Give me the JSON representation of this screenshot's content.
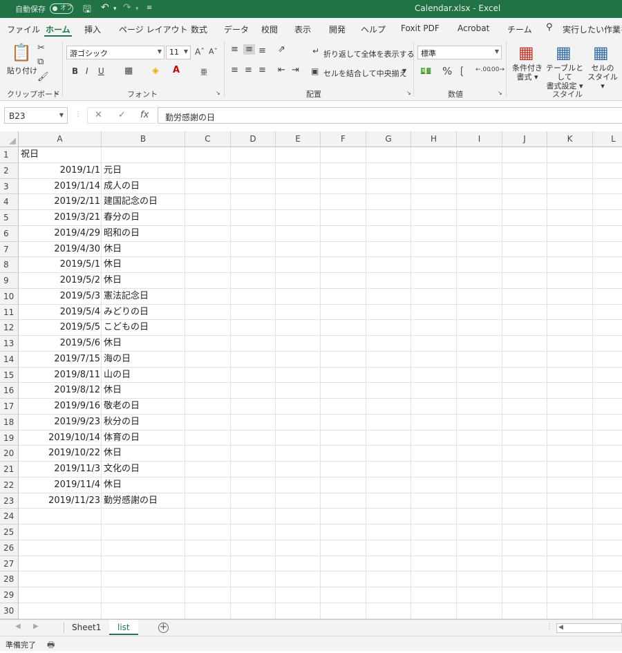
{
  "titlebar": {
    "autosave_label": "自動保存",
    "autosave_state": "オフ",
    "title": "Calendar.xlsx  -  Excel"
  },
  "tabs": [
    "ファイル",
    "ホーム",
    "挿入",
    "ページ レイアウト",
    "数式",
    "データ",
    "校閲",
    "表示",
    "開発",
    "ヘルプ",
    "Foxit PDF",
    "Acrobat",
    "チーム"
  ],
  "active_tab": "ホーム",
  "search_placeholder": "実行したい作業を",
  "ribbon": {
    "clipboard": {
      "paste": "貼り付け",
      "label": "クリップボード"
    },
    "font": {
      "name": "游ゴシック",
      "size": "11",
      "bold": "B",
      "italic": "I",
      "underline": "U",
      "label": "フォント"
    },
    "alignment": {
      "wrap_text": "折り返して全体を表示する",
      "merge_center": "セルを結合して中央揃え",
      "label": "配置"
    },
    "number": {
      "format": "標準",
      "label": "数値"
    },
    "styles": {
      "conditional": "条件付き\n書式",
      "as_table": "テーブルとして\n書式設定",
      "cell_styles": "セルの\nスタイル",
      "label": "スタイル"
    }
  },
  "formula_bar": {
    "name_box": "B23",
    "content": "勤労感謝の日"
  },
  "columns": [
    "A",
    "B",
    "C",
    "D",
    "E",
    "F",
    "G",
    "H",
    "I",
    "J",
    "K",
    "L"
  ],
  "header_cell": "祝日",
  "rows": [
    {
      "date": "2019/1/1",
      "name": "元日"
    },
    {
      "date": "2019/1/14",
      "name": "成人の日"
    },
    {
      "date": "2019/2/11",
      "name": "建国記念の日"
    },
    {
      "date": "2019/3/21",
      "name": "春分の日"
    },
    {
      "date": "2019/4/29",
      "name": "昭和の日"
    },
    {
      "date": "2019/4/30",
      "name": "休日"
    },
    {
      "date": "2019/5/1",
      "name": "休日"
    },
    {
      "date": "2019/5/2",
      "name": "休日"
    },
    {
      "date": "2019/5/3",
      "name": "憲法記念日"
    },
    {
      "date": "2019/5/4",
      "name": "みどりの日"
    },
    {
      "date": "2019/5/5",
      "name": "こどもの日"
    },
    {
      "date": "2019/5/6",
      "name": "休日"
    },
    {
      "date": "2019/7/15",
      "name": "海の日"
    },
    {
      "date": "2019/8/11",
      "name": "山の日"
    },
    {
      "date": "2019/8/12",
      "name": "休日"
    },
    {
      "date": "2019/9/16",
      "name": "敬老の日"
    },
    {
      "date": "2019/9/23",
      "name": "秋分の日"
    },
    {
      "date": "2019/10/14",
      "name": "体育の日"
    },
    {
      "date": "2019/10/22",
      "name": "休日"
    },
    {
      "date": "2019/11/3",
      "name": "文化の日"
    },
    {
      "date": "2019/11/4",
      "name": "休日"
    },
    {
      "date": "2019/11/23",
      "name": "勤労感謝の日"
    }
  ],
  "row_count": 30,
  "sheets": [
    "Sheet1",
    "list"
  ],
  "active_sheet": "list",
  "status": "準備完了",
  "colors": {
    "accent": "#217346"
  }
}
